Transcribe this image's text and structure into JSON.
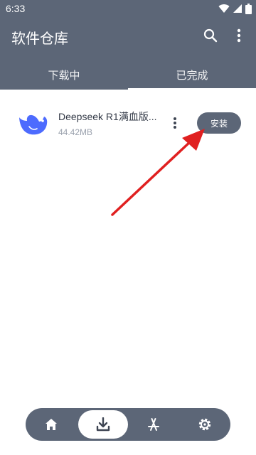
{
  "status_bar": {
    "time": "6:33"
  },
  "header": {
    "title": "软件仓库"
  },
  "tabs": [
    {
      "label": "下载中",
      "selected": false
    },
    {
      "label": "已完成",
      "selected": true
    }
  ],
  "downloads": [
    {
      "name": "Deepseek R1满血版...",
      "size": "44.42MB",
      "action_label": "安装"
    }
  ],
  "bottom_nav": [
    {
      "icon": "home-icon",
      "selected": false
    },
    {
      "icon": "download-icon",
      "selected": true
    },
    {
      "icon": "app-store-icon",
      "selected": false
    },
    {
      "icon": "settings-icon",
      "selected": false
    }
  ],
  "colors": {
    "primary": "#5c6677",
    "background": "#ffffff",
    "annotation_arrow": "#e02020",
    "app_icon": "#4d6bfe"
  }
}
